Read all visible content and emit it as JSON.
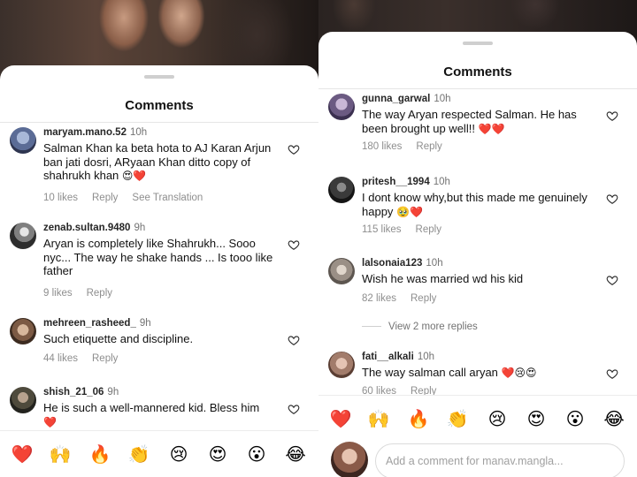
{
  "left": {
    "title": "Comments",
    "comments": [
      {
        "username": "maryam.mano.52",
        "time": "10h",
        "text": "Salman Khan ka beta hota to AJ Karan Arjun ban jati dosri, ARyaan Khan ditto copy of shahrukh khan",
        "emojis": "😍❤️",
        "likes": "10 likes",
        "reply": "Reply",
        "extra": "See Translation"
      },
      {
        "username": "zenab.sultan.9480",
        "time": "9h",
        "text": "Aryan is completely like Shahrukh... Sooo nyc... The way he shake hands ... Is tooo like father",
        "emojis": "",
        "likes": "9 likes",
        "reply": "Reply"
      },
      {
        "username": "mehreen_rasheed_",
        "time": "9h",
        "text": "Such etiquette and discipline.",
        "emojis": "",
        "likes": "44 likes",
        "reply": "Reply"
      },
      {
        "username": "shish_21_06",
        "time": "9h",
        "text": "He is such a well-mannered kid. Bless him",
        "emojis": "❤️",
        "likes": "",
        "reply": ""
      }
    ],
    "emoji_bar": [
      "❤️",
      "🙌",
      "🔥",
      "👏",
      "😢",
      "😍",
      "😮",
      "😂"
    ]
  },
  "right": {
    "title": "Comments",
    "comments": [
      {
        "username": "gunna_garwal",
        "time": "10h",
        "text": "The way Aryan respected Salman. He has been brought up well!!",
        "emojis": "❤️❤️",
        "likes": "180 likes",
        "reply": "Reply"
      },
      {
        "username": "pritesh__1994",
        "time": "10h",
        "text": "I dont know why,but this made me genuinely happy",
        "emojis": "🥹❤️",
        "likes": "115 likes",
        "reply": "Reply"
      },
      {
        "username": "lalsonaia123",
        "time": "10h",
        "text": "Wish he was married wd his kid",
        "emojis": "",
        "likes": "82 likes",
        "reply": "Reply"
      },
      {
        "username": "fati__alkali",
        "time": "10h",
        "text": "The way salman call aryan",
        "emojis": "❤️😢😍",
        "likes": "60 likes",
        "reply": "Reply"
      }
    ],
    "view_replies": "View 2 more replies",
    "emoji_bar": [
      "❤️",
      "🙌",
      "🔥",
      "👏",
      "😢",
      "😍",
      "😮",
      "😂"
    ],
    "input_placeholder": "Add a comment for manav.mangla..."
  },
  "icons": {
    "heart": "heart-outline-icon"
  }
}
